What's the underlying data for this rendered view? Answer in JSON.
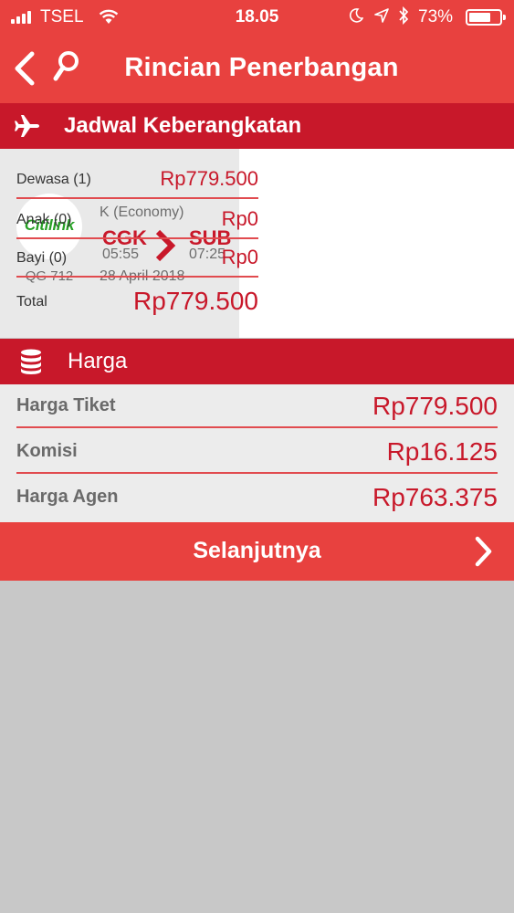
{
  "status_bar": {
    "carrier": "TSEL",
    "time": "18.05",
    "battery": "73%",
    "battery_level": 0.73
  },
  "header": {
    "title": "Rincian Penerbangan",
    "back_icon": "chevron-left-icon",
    "search_icon": "search-icon"
  },
  "departure_section": {
    "title": "Jadwal Keberangkatan",
    "icon": "airplane-icon"
  },
  "flight": {
    "airline_logo_text": "Citilink",
    "flight_number": "QG 712",
    "class": "K (Economy)",
    "origin": "CGK",
    "destination": "SUB",
    "departure_time": "05:55",
    "arrival_time": "07:25",
    "date": "28 April 2018"
  },
  "passengers": [
    {
      "label": "Dewasa (1)",
      "price": "Rp779.500"
    },
    {
      "label": "Anak (0)",
      "price": "Rp0"
    },
    {
      "label": "Bayi (0)",
      "price": "Rp0"
    }
  ],
  "total": {
    "label": "Total",
    "price": "Rp779.500"
  },
  "price_section": {
    "title": "Harga",
    "icon": "database-icon"
  },
  "prices": [
    {
      "label": "Harga Tiket",
      "value": "Rp779.500"
    },
    {
      "label": "Komisi",
      "value": "Rp16.125"
    },
    {
      "label": "Harga Agen",
      "value": "Rp763.375"
    }
  ],
  "next_button": {
    "label": "Selanjutnya"
  },
  "colors": {
    "header_red": "#e8413f",
    "section_red": "#c8182a",
    "price_red": "#c8182a",
    "airline_green": "#27a025",
    "background_gray": "#c8c8c8"
  }
}
